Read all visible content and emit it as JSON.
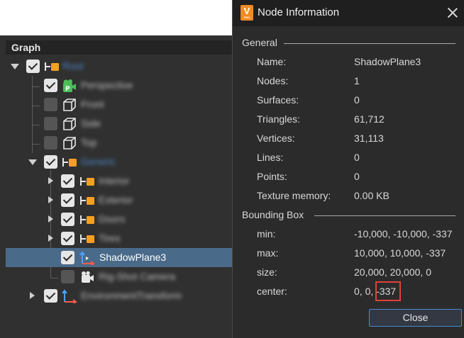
{
  "graph": {
    "title": "Graph",
    "items": [
      {
        "label": "Root"
      },
      {
        "label": "Perspective"
      },
      {
        "label": "Front"
      },
      {
        "label": "Side"
      },
      {
        "label": "Top"
      },
      {
        "label": "Generic"
      },
      {
        "label": "Interior"
      },
      {
        "label": "Exterior"
      },
      {
        "label": "Doors"
      },
      {
        "label": "Tires"
      },
      {
        "label": "ShadowPlane3"
      },
      {
        "label": "Rig-Shot Camera"
      },
      {
        "label": "EnvironmentTransform"
      }
    ]
  },
  "dialog": {
    "title": "Node Information",
    "logo_letter": "V",
    "logo_sub": "PRO",
    "general": {
      "label": "General",
      "rows": [
        {
          "key": "Name:",
          "value": "ShadowPlane3"
        },
        {
          "key": "Nodes:",
          "value": "1"
        },
        {
          "key": "Surfaces:",
          "value": "0"
        },
        {
          "key": "Triangles:",
          "value": "61,712"
        },
        {
          "key": "Vertices:",
          "value": "31,113"
        },
        {
          "key": "Lines:",
          "value": "0"
        },
        {
          "key": "Points:",
          "value": "0"
        },
        {
          "key": "Texture memory:",
          "value": "0.00 KB"
        }
      ]
    },
    "bbox": {
      "label": "Bounding Box",
      "rows": [
        {
          "key": "min:",
          "value": "-10,000, -10,000, -337"
        },
        {
          "key": "max:",
          "value": "10,000, 10,000, -337"
        },
        {
          "key": "size:",
          "value": "20,000, 20,000, 0"
        },
        {
          "key": "center:",
          "value": "0, 0, -337"
        }
      ]
    },
    "close_label": "Close"
  },
  "colors": {
    "accent_orange": "#f5a020",
    "selection": "#4a6a8a",
    "highlight_red": "#e0413b",
    "button_border": "#4d8ad0"
  }
}
